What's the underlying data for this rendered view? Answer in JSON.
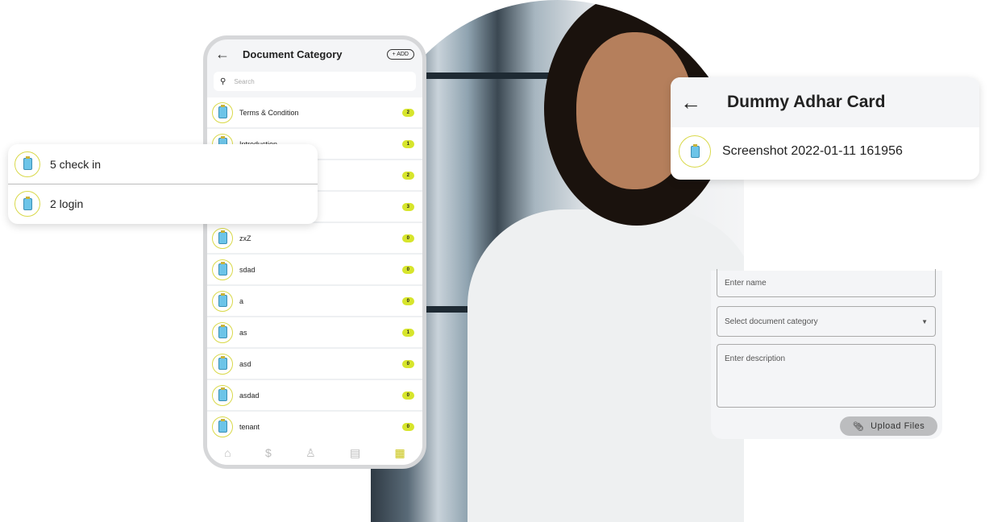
{
  "phone": {
    "title": "Document Category",
    "add_label": "+ ADD",
    "search_placeholder": "Search",
    "items": [
      {
        "label": "Terms & Condition",
        "count": "2"
      },
      {
        "label": "Introduction",
        "count": "1"
      },
      {
        "label": "",
        "count": "2"
      },
      {
        "label": "",
        "count": "3"
      },
      {
        "label": "zxZ",
        "count": "0"
      },
      {
        "label": "sdad",
        "count": "0"
      },
      {
        "label": "a",
        "count": "0"
      },
      {
        "label": "as",
        "count": "1"
      },
      {
        "label": "asd",
        "count": "0"
      },
      {
        "label": "asdad",
        "count": "0"
      },
      {
        "label": "tenant",
        "count": "0"
      }
    ],
    "nav_icons": [
      "home-icon",
      "payment-icon",
      "helpdesk-icon",
      "notice-icon",
      "more-grid-icon"
    ]
  },
  "checks": {
    "items": [
      "5 check in",
      "2 login"
    ]
  },
  "adhar": {
    "title": "Dummy Adhar Card",
    "file": "Screenshot 2022-01-11 161956"
  },
  "form": {
    "name_placeholder": "Enter name",
    "category_placeholder": "Select document category",
    "description_placeholder": "Enter description",
    "upload_label": "Upload Files"
  },
  "colors": {
    "accent": "#d7e52c",
    "panel": "#f4f5f7"
  }
}
